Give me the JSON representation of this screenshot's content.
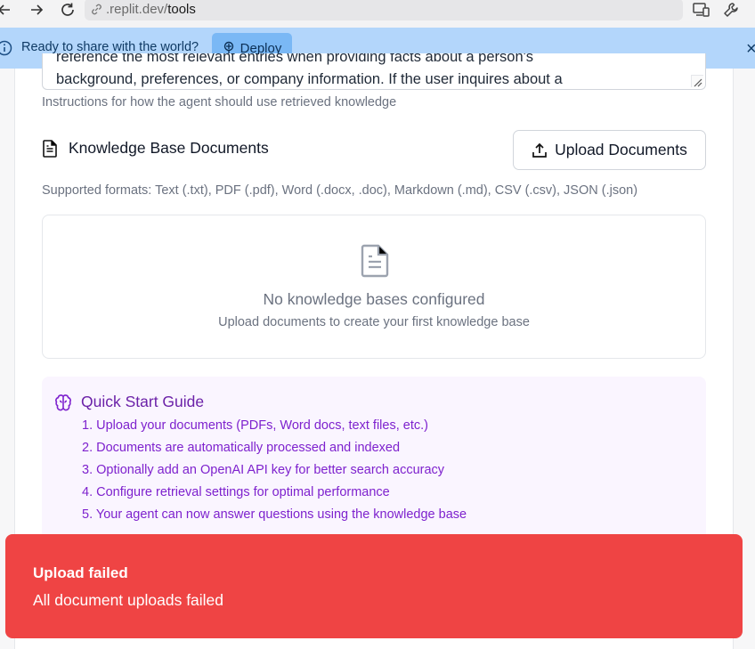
{
  "browser": {
    "url_domain": ".replit.dev/",
    "url_path": "tools"
  },
  "banner": {
    "text": "Ready to share with the world?",
    "deploy_label": "Deploy",
    "close_glyph": "×"
  },
  "instructions": {
    "textarea_line1": "reference the most relevant entries when providing facts about a person's",
    "textarea_line2": "background, preferences, or company information. If the user inquires about a",
    "helper": "Instructions for how the agent should use retrieved knowledge"
  },
  "knowledge_base": {
    "heading": "Knowledge Base Documents",
    "upload_label": "Upload Documents",
    "formats": "Supported formats: Text (.txt), PDF (.pdf), Word (.docx, .doc), Markdown (.md), CSV (.csv), JSON (.json)",
    "empty_title": "No knowledge bases configured",
    "empty_subtitle": "Upload documents to create your first knowledge base"
  },
  "quick_start": {
    "title": "Quick Start Guide",
    "steps": [
      "1. Upload your documents (PDFs, Word docs, text files, etc.)",
      "2. Documents are automatically processed and indexed",
      "3. Optionally add an OpenAI API key for better search accuracy",
      "4. Configure retrieval settings for optimal performance",
      "5. Your agent can now answer questions using the knowledge base"
    ]
  },
  "toast": {
    "title": "Upload failed",
    "message": "All document uploads failed"
  },
  "colors": {
    "banner_bg": "#b3d6fb",
    "deploy_bg": "#7ab8f5",
    "guide_bg": "#faf5ff",
    "guide_text": "#7e22ce",
    "toast_bg": "#ef4444"
  },
  "icons": {
    "back": "back-arrow-icon",
    "forward": "forward-arrow-icon",
    "reload": "reload-icon",
    "link": "link-icon",
    "devices": "devices-icon",
    "tools": "wrench-icon",
    "info": "info-icon",
    "deploy": "deploy-icon",
    "document": "document-icon",
    "upload": "upload-icon",
    "brain": "brain-icon"
  }
}
